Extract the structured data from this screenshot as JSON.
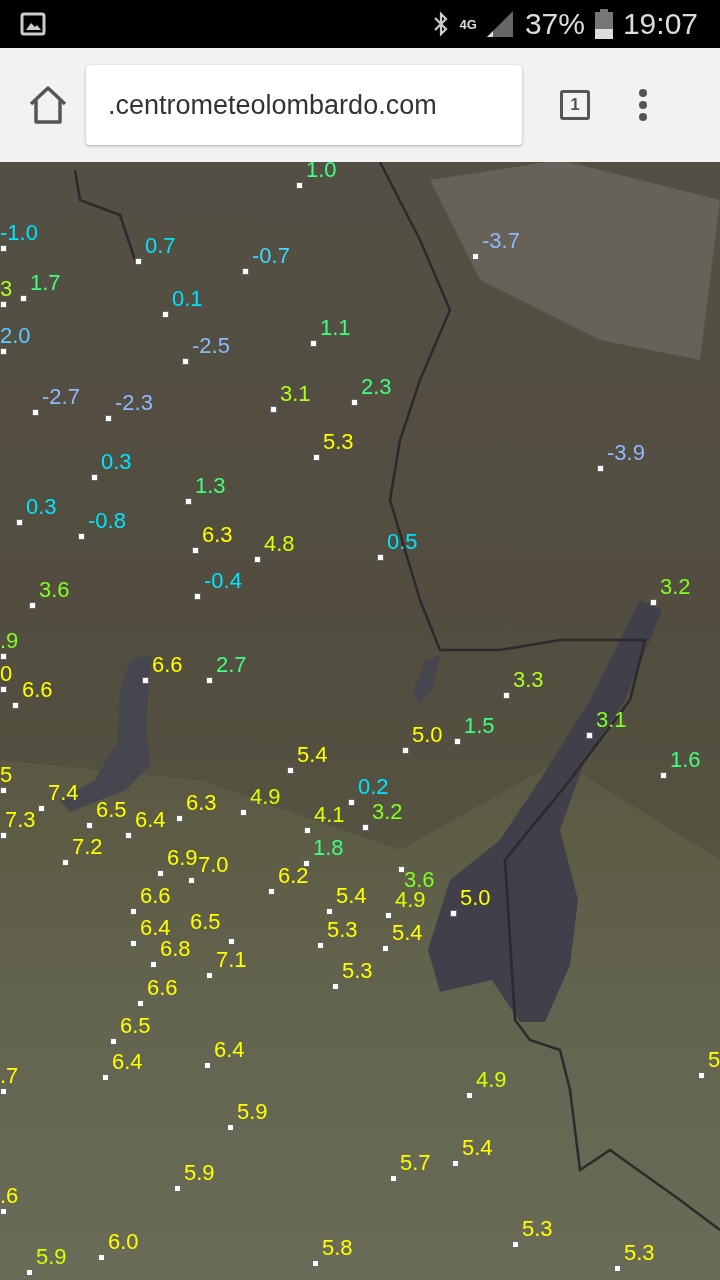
{
  "status_bar": {
    "network": "4G",
    "battery": "37%",
    "time": "19:07"
  },
  "browser": {
    "url": ".centrometeolombardo.com",
    "tab_count": "1"
  },
  "map": {
    "labels": [
      {
        "text": "1.0",
        "color": "#40ff80"
      },
      {
        "text": "-1.0",
        "color": "#00e5ff"
      },
      {
        "text": "0.7",
        "color": "#00e5ff"
      },
      {
        "text": "-0.7",
        "color": "#40d8ff"
      },
      {
        "text": "-3.7",
        "color": "#90b8ff"
      },
      {
        "text": "3",
        "color": "#b0ff20"
      },
      {
        "text": "1.7",
        "color": "#40ff80"
      },
      {
        "text": "0.1",
        "color": "#00e5ff"
      },
      {
        "text": "2.0",
        "color": "#60c8ff"
      },
      {
        "text": "1.1",
        "color": "#40ff80"
      },
      {
        "text": "-2.5",
        "color": "#90b8ff"
      },
      {
        "text": "-2.7",
        "color": "#90b8ff"
      },
      {
        "text": "-2.3",
        "color": "#90b8ff"
      },
      {
        "text": "3.1",
        "color": "#b0ff20"
      },
      {
        "text": "2.3",
        "color": "#40ff80"
      },
      {
        "text": "5.3",
        "color": "#ffff00"
      },
      {
        "text": "-3.9",
        "color": "#90b8ff"
      },
      {
        "text": "0.3",
        "color": "#00e5ff"
      },
      {
        "text": "1.3",
        "color": "#40ff80"
      },
      {
        "text": "0.3",
        "color": "#00e5ff"
      },
      {
        "text": "-0.8",
        "color": "#00e5ff"
      },
      {
        "text": "6.3",
        "color": "#ffff00"
      },
      {
        "text": "4.8",
        "color": "#d8ff00"
      },
      {
        "text": "0.5",
        "color": "#00e5ff"
      },
      {
        "text": "3.6",
        "color": "#80ff20"
      },
      {
        "text": "-0.4",
        "color": "#00e5ff"
      },
      {
        "text": "3.2",
        "color": "#80ff20"
      },
      {
        "text": ".9",
        "color": "#80ff20"
      },
      {
        "text": "6.6",
        "color": "#ffff00"
      },
      {
        "text": "2.7",
        "color": "#40ff80"
      },
      {
        "text": "0",
        "color": "#ffff00"
      },
      {
        "text": "6.6",
        "color": "#ffff00"
      },
      {
        "text": "3.3",
        "color": "#b0ff20"
      },
      {
        "text": "5.0",
        "color": "#ffff00"
      },
      {
        "text": "1.5",
        "color": "#40ff80"
      },
      {
        "text": "3.1",
        "color": "#80ff20"
      },
      {
        "text": "1.6",
        "color": "#40ff80"
      },
      {
        "text": "5",
        "color": "#ffff00"
      },
      {
        "text": "5.4",
        "color": "#ffff00"
      },
      {
        "text": "7.4",
        "color": "#ffff00"
      },
      {
        "text": "6.5",
        "color": "#ffff00"
      },
      {
        "text": "6.3",
        "color": "#ffff00"
      },
      {
        "text": "4.9",
        "color": "#d8ff00"
      },
      {
        "text": "0.2",
        "color": "#00e5ff"
      },
      {
        "text": "7.3",
        "color": "#ffff00"
      },
      {
        "text": "6.4",
        "color": "#ffff00"
      },
      {
        "text": "4.1",
        "color": "#d8ff00"
      },
      {
        "text": "3.2",
        "color": "#80ff20"
      },
      {
        "text": "7.2",
        "color": "#ffff00"
      },
      {
        "text": "1.8",
        "color": "#40ff80"
      },
      {
        "text": "6.9",
        "color": "#ffff00"
      },
      {
        "text": "7.0",
        "color": "#ffff00"
      },
      {
        "text": "6.2",
        "color": "#ffff00"
      },
      {
        "text": "3.6",
        "color": "#80ff20"
      },
      {
        "text": "6.6",
        "color": "#ffff00"
      },
      {
        "text": "5.4",
        "color": "#ffff00"
      },
      {
        "text": "4.9",
        "color": "#d8ff00"
      },
      {
        "text": "5.0",
        "color": "#ffff00"
      },
      {
        "text": "6.5",
        "color": "#ffff00"
      },
      {
        "text": "6.4",
        "color": "#ffff00"
      },
      {
        "text": "5.3",
        "color": "#ffff00"
      },
      {
        "text": "5.4",
        "color": "#ffff00"
      },
      {
        "text": "6.8",
        "color": "#ffff00"
      },
      {
        "text": "7.1",
        "color": "#ffff00"
      },
      {
        "text": "5.3",
        "color": "#ffff00"
      },
      {
        "text": "6.6",
        "color": "#ffff00"
      },
      {
        "text": "6.5",
        "color": "#ffff00"
      },
      {
        "text": "6.4",
        "color": "#ffff00"
      },
      {
        "text": "6.4",
        "color": "#ffff00"
      },
      {
        "text": "4.9",
        "color": "#d8ff00"
      },
      {
        "text": "5",
        "color": "#ffff00"
      },
      {
        "text": ".7",
        "color": "#ffff00"
      },
      {
        "text": "5.9",
        "color": "#ffff00"
      },
      {
        "text": "5.7",
        "color": "#ffff00"
      },
      {
        "text": "5.4",
        "color": "#ffff00"
      },
      {
        "text": "5.9",
        "color": "#ffff00"
      },
      {
        "text": ".6",
        "color": "#ffff00"
      },
      {
        "text": "5.9",
        "color": "#d8ff00"
      },
      {
        "text": "6.0",
        "color": "#ffff00"
      },
      {
        "text": "5.8",
        "color": "#ffff00"
      },
      {
        "text": "5.3",
        "color": "#ffff00"
      },
      {
        "text": "5.3",
        "color": "#ffff00"
      }
    ]
  }
}
